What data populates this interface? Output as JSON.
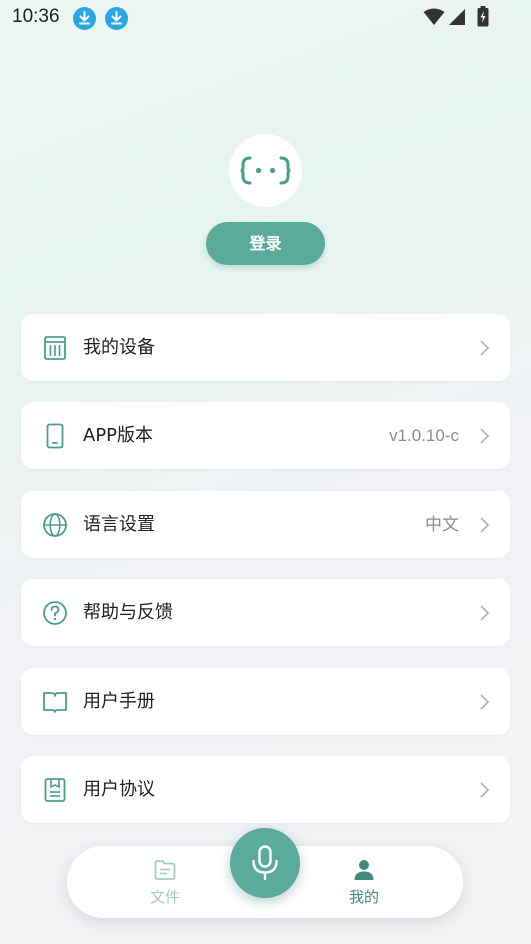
{
  "status_bar": {
    "time": "10:36",
    "notification_icons": [
      "download-icon",
      "download-icon"
    ],
    "right_icons": [
      "wifi-icon",
      "signal-icon",
      "battery-icon"
    ]
  },
  "profile": {
    "avatar_icon": "robot-face-icon",
    "login_label": "登录"
  },
  "menu": [
    {
      "id": "my-devices",
      "icon": "device-icon",
      "label": "我的设备",
      "value": ""
    },
    {
      "id": "app-version",
      "icon": "phone-icon",
      "label": "APP版本",
      "value": "v1.0.10-c"
    },
    {
      "id": "language-settings",
      "icon": "globe-icon",
      "label": "语言设置",
      "value": "中文"
    },
    {
      "id": "help-feedback",
      "icon": "help-icon",
      "label": "帮助与反馈",
      "value": ""
    },
    {
      "id": "user-manual",
      "icon": "book-icon",
      "label": "用户手册",
      "value": ""
    },
    {
      "id": "user-agreement",
      "icon": "agreement-icon",
      "label": "用户协议",
      "value": ""
    }
  ],
  "bottom_nav": {
    "items": [
      {
        "id": "files",
        "icon": "file-icon",
        "label": "文件",
        "active": false
      },
      {
        "id": "mine",
        "icon": "person-icon",
        "label": "我的",
        "active": true
      }
    ],
    "center_icon": "microphone-icon"
  },
  "colors": {
    "accent": "#5aab9b",
    "accent_dark": "#3f8c7d",
    "inactive": "#9fcfc3",
    "text": "#222222",
    "secondary_text": "#8c8c8c"
  }
}
